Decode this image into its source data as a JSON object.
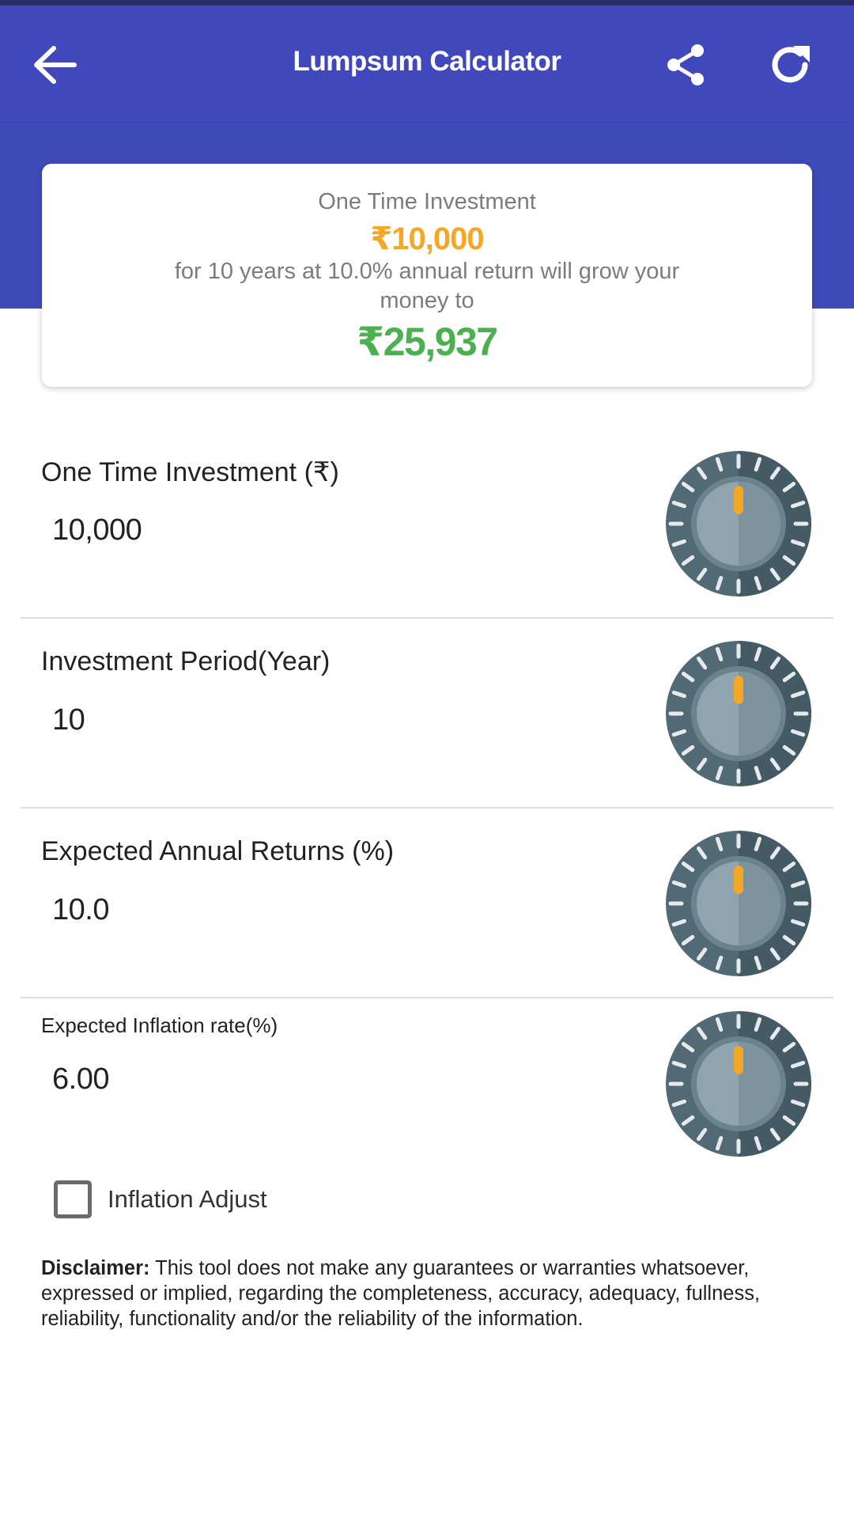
{
  "app": {
    "title": "Lumpsum Calculator",
    "accent_color": "#4048bc",
    "icons": {
      "back": "arrow-back-icon",
      "share": "share-icon",
      "refresh": "refresh-icon",
      "dial": "dial-knob-icon"
    }
  },
  "summary": {
    "label": "One Time Investment",
    "amount": "₹10,000",
    "description": "for 10 years at 10.0% annual return will grow your money to",
    "result": "₹25,937",
    "amount_color": "#f5a623",
    "result_color": "#4caf50"
  },
  "fields": [
    {
      "label": "One Time Investment (₹)",
      "value": "10,000"
    },
    {
      "label": "Investment Period(Year)",
      "value": "10"
    },
    {
      "label": "Expected Annual Returns (%)",
      "value": "10.0"
    },
    {
      "label": "Expected Inflation rate(%)",
      "value": "6.00"
    }
  ],
  "inflation_adjust": {
    "label": "Inflation Adjust",
    "checked": false
  },
  "disclaimer": {
    "heading": "Disclaimer:",
    "text": " This tool does not make any guarantees or warranties whatsoever, expressed or implied, regarding the completeness, accuracy, adequacy, fullness, reliability, functionality and/or the reliability of the information."
  }
}
